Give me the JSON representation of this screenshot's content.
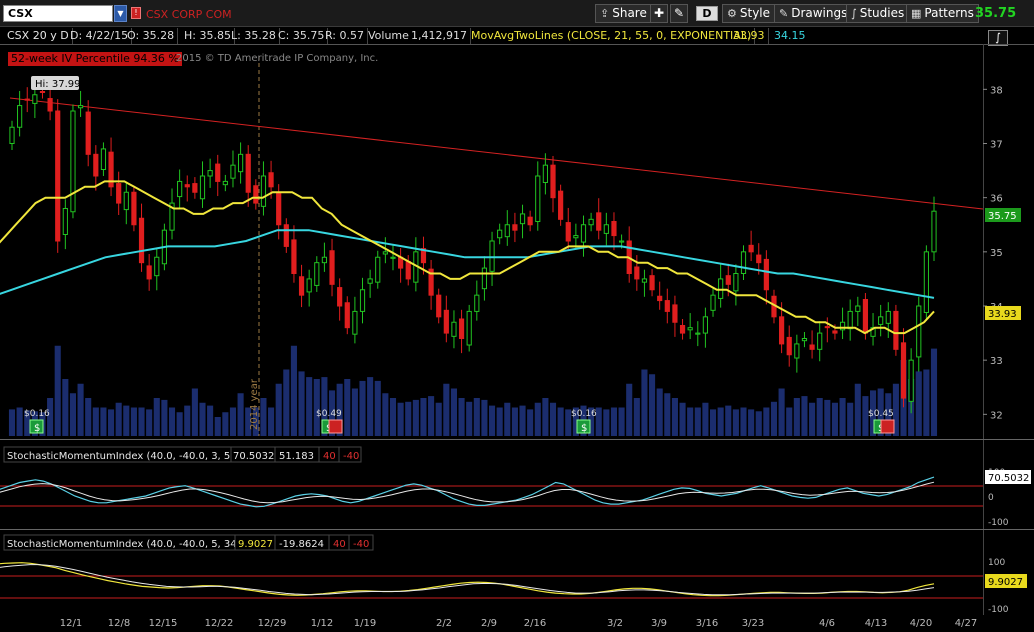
{
  "toolbar": {
    "symbol": "CSX",
    "company": "CSX CORP COM",
    "share": "Share",
    "period": "D",
    "style": "Style",
    "drawings": "Drawings",
    "studies": "Studies",
    "patterns": "Patterns",
    "last_price": "35.75"
  },
  "header": {
    "desc": "CSX 20 y D",
    "date": "D: 4/22/15",
    "open": "O: 35.28",
    "high": "H: 35.85",
    "low": "L: 35.28",
    "close": "C: 35.75",
    "range": "R: 0.57",
    "volume_label": "Volume",
    "volume": "1,412,917",
    "study": "MovAvgTwoLines (CLOSE, 21, 55, 0, EXPONENTIAL)",
    "ma1": "33.93",
    "ma2": "34.15"
  },
  "iv_label": "52-week IV Percentile 94.36 %",
  "copyright": "2015 © TD Ameritrade IP Company, Inc.",
  "hi_label": "Hi: 37.99",
  "year_label": "2014 year",
  "colors": {
    "up": "#21c321",
    "down": "#e01e1e",
    "ma_fast": "#f0e63c",
    "ma_slow": "#38d6e0",
    "volume": "#1b2d6e",
    "trend": "#d42222",
    "osc_a": "#5ad0e6",
    "osc_b": "#e8e8e8",
    "osc_c": "#f0e63c"
  },
  "dividends": [
    {
      "label": "$0.16"
    },
    {
      "label": "$0.49"
    },
    {
      "label": "$0.16"
    },
    {
      "label": "$0.45"
    }
  ],
  "smi1": {
    "title": "StochasticMomentumIndex (40.0, -40.0, 3, 5)",
    "v1": "70.5032",
    "v2": "51.183",
    "ob": "40",
    "os": "-40",
    "marker": "70.5032",
    "t_top": "100",
    "t_zero": "0",
    "t_bot": "-100"
  },
  "smi2": {
    "title": "StochasticMomentumIndex (40.0, -40.0, 5, 34)",
    "v1": "9.9027",
    "v2": "-19.8624",
    "ob": "40",
    "os": "-40",
    "marker": "9.9027",
    "t_top": "100",
    "t_bot": "-100"
  },
  "chart_data": {
    "type": "candlestick",
    "symbol": "CSX",
    "y_ticks": [
      32,
      33,
      34,
      35,
      36,
      37,
      38
    ],
    "ylim": [
      31.6,
      38.8
    ],
    "x_ticks": [
      "12/1",
      "12/8",
      "12/15",
      "12/22",
      "12/29",
      "1/12",
      "1/19",
      "2/2",
      "2/9",
      "2/16",
      "3/2",
      "3/9",
      "3/16",
      "3/23",
      "4/6",
      "4/13",
      "4/20",
      "4/27"
    ],
    "last_close": 35.75,
    "ma_fast_last": 33.93,
    "ma_slow_last": 34.15,
    "close": [
      37.3,
      37.7,
      37.8,
      37.9,
      37.95,
      37.6,
      35.2,
      35.8,
      37.6,
      37.7,
      36.8,
      36.4,
      36.9,
      36.2,
      35.9,
      36.1,
      35.5,
      34.8,
      34.5,
      34.9,
      35.4,
      35.9,
      36.3,
      36.2,
      36.1,
      36.4,
      36.5,
      36.3,
      36.3,
      36.6,
      36.8,
      36.1,
      35.9,
      36.4,
      36.2,
      35.5,
      35.1,
      34.6,
      34.2,
      34.5,
      34.8,
      34.9,
      34.4,
      34.0,
      33.6,
      33.9,
      34.3,
      34.5,
      34.9,
      35.0,
      34.9,
      34.7,
      34.5,
      35.0,
      34.8,
      34.2,
      33.8,
      33.5,
      33.7,
      33.4,
      33.9,
      34.2,
      34.7,
      35.2,
      35.4,
      35.5,
      35.4,
      35.7,
      35.5,
      36.4,
      36.6,
      36.0,
      35.6,
      35.2,
      35.3,
      35.5,
      35.6,
      35.4,
      35.5,
      35.3,
      35.2,
      34.6,
      34.5,
      34.5,
      34.3,
      34.1,
      33.9,
      33.7,
      33.5,
      33.6,
      33.5,
      33.8,
      34.2,
      34.5,
      34.4,
      34.6,
      35.0,
      35.0,
      34.8,
      34.3,
      33.8,
      33.3,
      33.1,
      33.3,
      33.4,
      33.2,
      33.5,
      33.6,
      33.5,
      33.7,
      33.9,
      34.0,
      33.5,
      33.6,
      33.8,
      33.9,
      33.2,
      32.3,
      33.0,
      34.0,
      35.0,
      35.75
    ],
    "ma_fast": [
      35.1,
      35.3,
      35.5,
      35.7,
      35.9,
      36.0,
      36.0,
      36.0,
      36.1,
      36.2,
      36.2,
      36.3,
      36.3,
      36.3,
      36.2,
      36.1,
      36.0,
      35.9,
      35.8,
      35.8,
      35.7,
      35.7,
      35.8,
      35.8,
      35.9,
      35.9,
      36.0,
      36.0,
      36.1,
      36.1,
      36.1,
      36.0,
      36.0,
      35.8,
      35.7,
      35.5,
      35.4,
      35.3,
      35.2,
      35.1,
      35.0,
      34.9,
      34.8,
      34.7,
      34.6,
      34.6,
      34.5,
      34.5,
      34.6,
      34.6,
      34.6,
      34.6,
      34.7,
      34.8,
      34.9,
      35.0,
      35.0,
      35.0,
      35.1,
      35.1,
      35.1,
      35.0,
      35.0,
      34.9,
      34.9,
      34.8,
      34.8,
      34.7,
      34.7,
      34.6,
      34.6,
      34.5,
      34.4,
      34.3,
      34.3,
      34.2,
      34.2,
      34.2,
      34.1,
      34.0,
      33.9,
      33.8,
      33.8,
      33.7,
      33.7,
      33.6,
      33.6,
      33.6,
      33.5,
      33.6,
      33.6,
      33.5,
      33.5,
      33.6,
      33.7,
      33.9
    ],
    "ma_slow": [
      34.2,
      34.3,
      34.4,
      34.5,
      34.6,
      34.7,
      34.8,
      34.9,
      34.95,
      35.0,
      35.05,
      35.1,
      35.1,
      35.1,
      35.1,
      35.15,
      35.2,
      35.3,
      35.4,
      35.4,
      35.4,
      35.35,
      35.3,
      35.25,
      35.2,
      35.15,
      35.1,
      35.05,
      35.0,
      34.95,
      34.9,
      34.9,
      34.9,
      34.9,
      34.9,
      34.95,
      35.0,
      35.05,
      35.1,
      35.1,
      35.1,
      35.05,
      35.0,
      34.95,
      34.9,
      34.85,
      34.8,
      34.75,
      34.7,
      34.65,
      34.6,
      34.6,
      34.55,
      34.5,
      34.45,
      34.4,
      34.35,
      34.3,
      34.25,
      34.2,
      34.15
    ],
    "volume": [
      0.28,
      0.3,
      0.27,
      0.26,
      0.25,
      0.4,
      0.95,
      0.6,
      0.45,
      0.55,
      0.4,
      0.3,
      0.3,
      0.28,
      0.35,
      0.32,
      0.3,
      0.3,
      0.28,
      0.4,
      0.38,
      0.3,
      0.25,
      0.32,
      0.5,
      0.35,
      0.32,
      0.2,
      0.25,
      0.3,
      0.45,
      0.3,
      0.3,
      0.4,
      0.3,
      0.55,
      0.7,
      0.95,
      0.68,
      0.62,
      0.6,
      0.62,
      0.48,
      0.55,
      0.6,
      0.5,
      0.58,
      0.62,
      0.58,
      0.45,
      0.4,
      0.35,
      0.36,
      0.38,
      0.4,
      0.42,
      0.35,
      0.55,
      0.5,
      0.4,
      0.36,
      0.4,
      0.38,
      0.32,
      0.3,
      0.35,
      0.3,
      0.32,
      0.28,
      0.35,
      0.4,
      0.35,
      0.3,
      0.28,
      0.3,
      0.32,
      0.3,
      0.3,
      0.28,
      0.3,
      0.3,
      0.55,
      0.4,
      0.7,
      0.65,
      0.5,
      0.45,
      0.4,
      0.35,
      0.3,
      0.3,
      0.35,
      0.28,
      0.3,
      0.32,
      0.28,
      0.3,
      0.28,
      0.26,
      0.3,
      0.36,
      0.5,
      0.3,
      0.4,
      0.42,
      0.35,
      0.4,
      0.38,
      0.35,
      0.4,
      0.35,
      0.55,
      0.42,
      0.48,
      0.5,
      0.45,
      0.55,
      0.8,
      0.6,
      0.68,
      0.7,
      0.92
    ],
    "smi1_a": [
      20,
      30,
      40,
      50,
      55,
      60,
      55,
      45,
      30,
      15,
      0,
      -10,
      -20,
      -25,
      -25,
      -20,
      -15,
      -10,
      -5,
      0,
      10,
      20,
      30,
      35,
      38,
      30,
      20,
      10,
      0,
      -10,
      -20,
      -30,
      -35,
      -40,
      -38,
      -30,
      -20,
      -10,
      0,
      5,
      8,
      5,
      0,
      -10,
      -20,
      -25,
      -20,
      -10,
      0,
      10,
      20,
      30,
      40,
      45,
      40,
      30,
      20,
      5,
      -10,
      -20,
      -30,
      -35,
      -35,
      -30,
      -25,
      -20,
      -15,
      -5,
      5,
      20,
      35,
      50,
      45,
      30,
      15,
      0,
      -15,
      -25,
      -30,
      -30,
      -25,
      -20,
      -15,
      -5,
      5,
      15,
      25,
      30,
      28,
      20,
      10,
      5,
      0,
      5,
      10,
      20,
      30,
      38,
      30,
      20,
      10,
      0,
      -5,
      -8,
      -5,
      5,
      15,
      25,
      30,
      20,
      10,
      5,
      0,
      5,
      15,
      25,
      35,
      50,
      60,
      70
    ],
    "smi1_b": [
      10,
      18,
      26,
      34,
      40,
      44,
      46,
      44,
      38,
      30,
      20,
      10,
      0,
      -8,
      -14,
      -17,
      -18,
      -16,
      -13,
      -9,
      -4,
      2,
      9,
      16,
      22,
      26,
      26,
      23,
      18,
      12,
      5,
      -3,
      -11,
      -18,
      -23,
      -25,
      -24,
      -21,
      -16,
      -11,
      -6,
      -3,
      -1,
      -2,
      -5,
      -9,
      -12,
      -13,
      -11,
      -7,
      -2,
      4,
      11,
      18,
      23,
      26,
      26,
      22,
      16,
      9,
      1,
      -7,
      -14,
      -19,
      -22,
      -22,
      -21,
      -18,
      -13,
      -6,
      2,
      12,
      20,
      24,
      24,
      20,
      13,
      5,
      -3,
      -10,
      -15,
      -18,
      -19,
      -18,
      -15,
      -10,
      -4,
      2,
      8,
      12,
      14,
      13,
      11,
      10,
      11,
      13,
      17,
      22,
      25,
      25,
      23,
      19,
      14,
      9,
      5,
      3,
      4,
      6,
      10,
      14,
      17,
      17,
      15,
      13,
      12,
      13,
      16,
      21,
      28,
      36,
      44,
      51
    ],
    "smi2_a": [
      72,
      74,
      75,
      76,
      74,
      70,
      65,
      60,
      52,
      45,
      38,
      32,
      26,
      20,
      15,
      10,
      6,
      2,
      0,
      -2,
      -3,
      -2,
      0,
      2,
      4,
      4,
      3,
      0,
      -4,
      -8,
      -12,
      -16,
      -20,
      -23,
      -25,
      -26,
      -25,
      -23,
      -21,
      -18,
      -15,
      -13,
      -12,
      -12,
      -13,
      -14,
      -14,
      -13,
      -11,
      -8,
      -4,
      0,
      4,
      8,
      12,
      14,
      15,
      14,
      12,
      8,
      3,
      -2,
      -7,
      -12,
      -16,
      -19,
      -21,
      -22,
      -22,
      -20,
      -17,
      -13,
      -9,
      -6,
      -4,
      -4,
      -6,
      -9,
      -13,
      -17,
      -21,
      -24,
      -26,
      -27,
      -27,
      -26,
      -24,
      -22,
      -20,
      -18,
      -17,
      -17,
      -18,
      -19,
      -20,
      -20,
      -19,
      -17,
      -15,
      -14,
      -14,
      -15,
      -17,
      -18,
      -17,
      -15,
      -10,
      -2,
      5,
      10
    ],
    "smi2_b": [
      60,
      63,
      66,
      68,
      70,
      70,
      68,
      65,
      60,
      55,
      49,
      43,
      37,
      31,
      26,
      21,
      16,
      12,
      8,
      5,
      2,
      1,
      0,
      0,
      1,
      2,
      2,
      1,
      -1,
      -4,
      -7,
      -10,
      -14,
      -17,
      -20,
      -22,
      -23,
      -24,
      -23,
      -22,
      -20,
      -18,
      -16,
      -15,
      -14,
      -14,
      -14,
      -14,
      -13,
      -11,
      -9,
      -6,
      -3,
      1,
      4,
      7,
      10,
      11,
      11,
      10,
      8,
      5,
      1,
      -3,
      -7,
      -11,
      -14,
      -17,
      -19,
      -19,
      -19,
      -17,
      -15,
      -12,
      -10,
      -9,
      -9,
      -10,
      -12,
      -14,
      -17,
      -19,
      -21,
      -23,
      -24,
      -24,
      -24,
      -23,
      -22,
      -21,
      -20,
      -19,
      -19,
      -19,
      -19,
      -19,
      -19,
      -18,
      -17,
      -16,
      -16,
      -16,
      -16,
      -17,
      -17,
      -16,
      -15,
      -13,
      -10,
      -6,
      -2
    ]
  }
}
